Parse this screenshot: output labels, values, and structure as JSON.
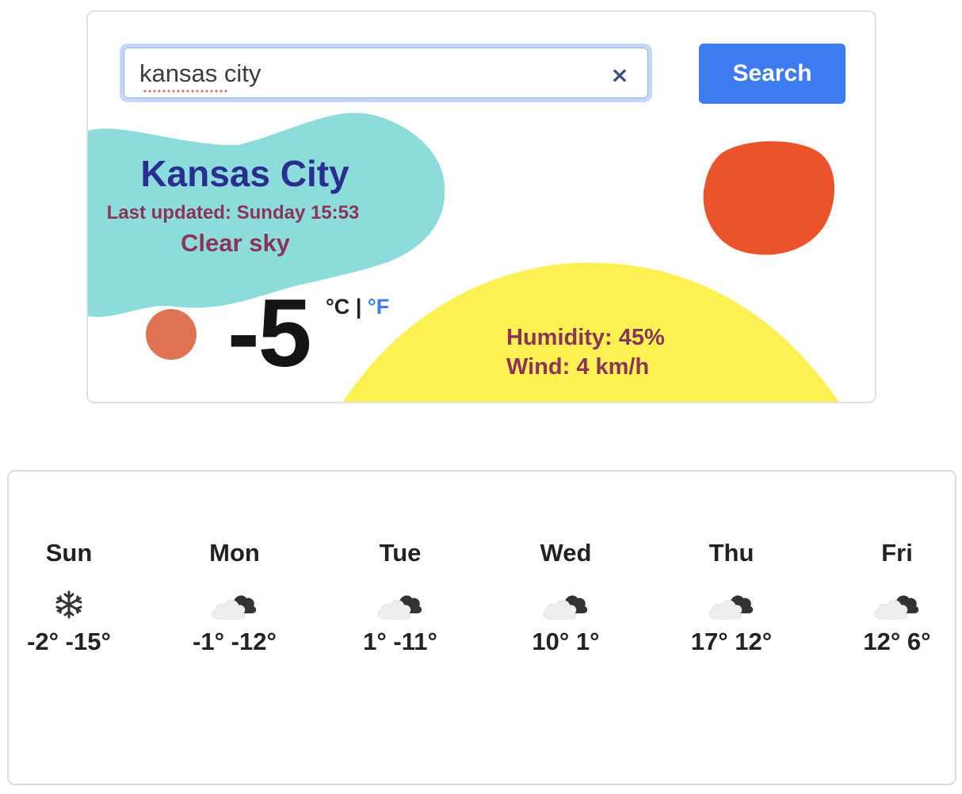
{
  "search": {
    "value": "kansas city",
    "clear_label": "×",
    "button_label": "Search"
  },
  "current": {
    "city": "Kansas City",
    "last_updated": "Last updated: Sunday 15:53",
    "description": "Clear sky",
    "temperature": "-5",
    "unit_celsius": "°C",
    "unit_separator": "|",
    "unit_fahrenheit": "°F",
    "humidity": "Humidity: 45%",
    "wind": "Wind: 4 km/h"
  },
  "forecast": [
    {
      "day": "Sun",
      "icon": "snowflake-icon",
      "temps": "-2° -15°"
    },
    {
      "day": "Mon",
      "icon": "cloudy-icon",
      "temps": "-1° -12°"
    },
    {
      "day": "Tue",
      "icon": "cloudy-icon",
      "temps": "1° -11°"
    },
    {
      "day": "Wed",
      "icon": "cloudy-icon",
      "temps": "10° 1°"
    },
    {
      "day": "Thu",
      "icon": "cloudy-icon",
      "temps": "17° 12°"
    },
    {
      "day": "Fri",
      "icon": "cloudy-icon",
      "temps": "12° 6°"
    }
  ],
  "colors": {
    "teal_blob": "#8ddcdc",
    "yellow_blob": "#fdf052",
    "red_blob": "#eb532b",
    "small_circle": "#df7455",
    "city_text": "#2a2f8f",
    "detail_text": "#8a3557",
    "accent": "#3d7cf0"
  }
}
